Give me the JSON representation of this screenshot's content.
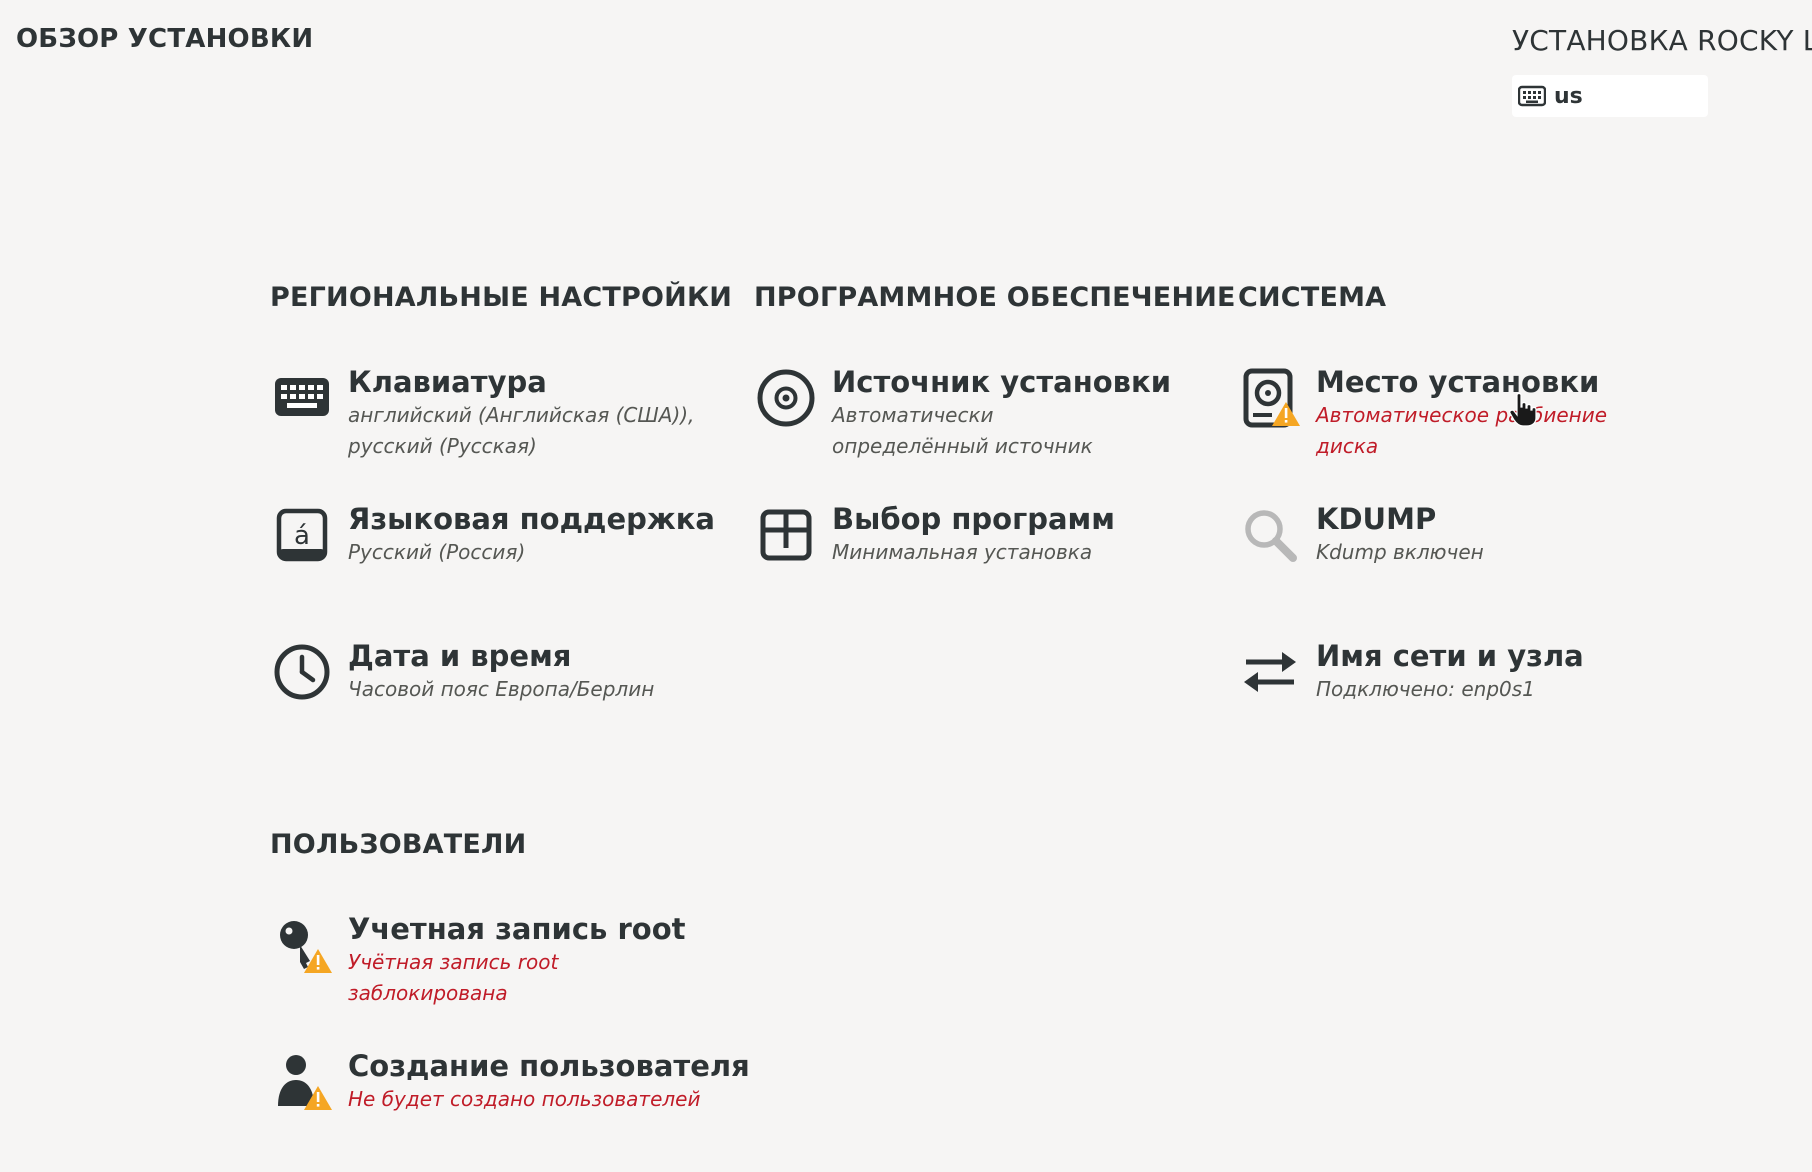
{
  "header": {
    "title": "ОБЗОР УСТАНОВКИ",
    "product_title": "УСТАНОВКА ROCKY LI",
    "keyboard_layout": "us"
  },
  "colors": {
    "background": "#f6f5f4",
    "text": "#2e3436",
    "status_text": "#555753",
    "warning_text": "#c01c28",
    "warning_icon": "#f5a623",
    "disabled_icon": "#b8b8b8"
  },
  "categories": {
    "localization": "РЕГИОНАЛЬНЫЕ НАСТРОЙКИ",
    "software": "ПРОГРАММНОЕ ОБЕСПЕЧЕНИЕ",
    "system": "СИСТЕМА",
    "users": "ПОЛЬЗОВАТЕЛИ"
  },
  "spokes": {
    "keyboard": {
      "title": "Клавиатура",
      "status": "английский (Английская (США)),\nрусский (Русская)",
      "icon": "keyboard-icon",
      "warning": false
    },
    "language": {
      "title": "Языковая поддержка",
      "status": "Русский (Россия)",
      "icon": "language-icon",
      "warning": false
    },
    "datetime": {
      "title": "Дата и время",
      "status": "Часовой пояс Европа/Берлин",
      "icon": "clock-icon",
      "warning": false
    },
    "source": {
      "title": "Источник установки",
      "status": "Автоматически\nопределённый источник",
      "icon": "disc-icon",
      "warning": false
    },
    "software": {
      "title": "Выбор программ",
      "status": "Минимальная установка",
      "icon": "package-icon",
      "warning": false
    },
    "destination": {
      "title": "Место установки",
      "status": "Автоматическое разбиение\nдиска",
      "icon": "harddisk-warning-icon",
      "warning": true
    },
    "kdump": {
      "title": "KDUMP",
      "status": "Kdump включен",
      "icon": "magnifier-icon",
      "warning": false
    },
    "network": {
      "title": "Имя сети и узла",
      "status": "Подключено: enp0s1",
      "icon": "network-arrows-icon",
      "warning": false
    },
    "root": {
      "title": "Учетная запись root",
      "status": "Учётная запись root\nзаблокирована",
      "icon": "key-warning-icon",
      "warning": true
    },
    "user": {
      "title": "Создание пользователя",
      "status": "Не будет создано пользователей",
      "icon": "user-warning-icon",
      "warning": true
    }
  }
}
